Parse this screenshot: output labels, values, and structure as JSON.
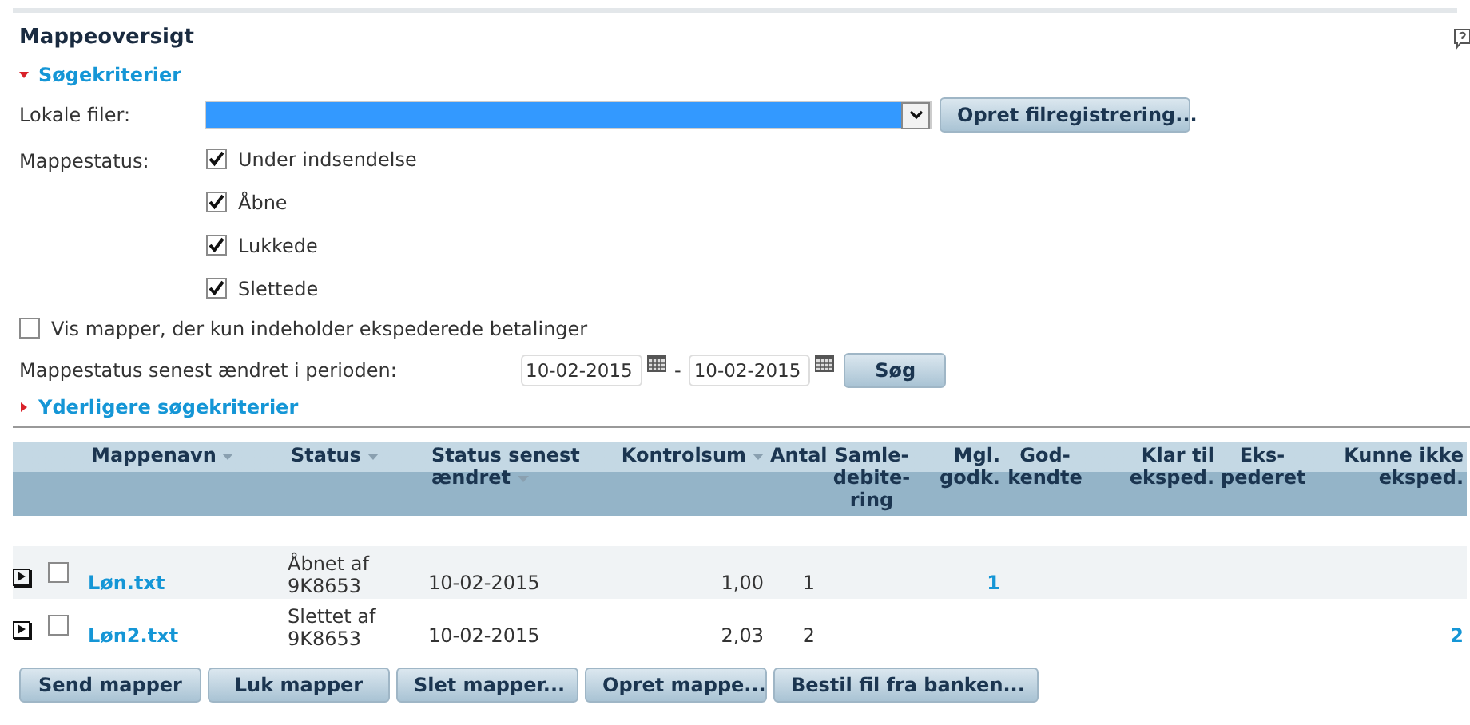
{
  "title": "Mappeoversigt",
  "search_section": {
    "label": "Søgekriterier",
    "expanded": true
  },
  "local_files": {
    "label": "Lokale filer:",
    "button": "Opret filregistrering..."
  },
  "folder_status": {
    "label": "Mappestatus:",
    "options": [
      {
        "label": "Under indsendelse",
        "checked": true
      },
      {
        "label": "Åbne",
        "checked": true
      },
      {
        "label": "Lukkede",
        "checked": true
      },
      {
        "label": "Slettede",
        "checked": true
      }
    ]
  },
  "only_expedited": {
    "label": "Vis mapper, der kun indeholder ekspederede betalinger",
    "checked": false
  },
  "period": {
    "label": "Mappestatus senest ændret i perioden:",
    "from": "10-02-2015",
    "separator": "-",
    "to": "10-02-2015",
    "button": "Søg"
  },
  "more_section": {
    "label": "Yderligere søgekriterier",
    "expanded": false
  },
  "table": {
    "columns": [
      {
        "lines": [
          "Mappenavn"
        ],
        "sortable": true
      },
      {
        "lines": [
          "Status"
        ],
        "sortable": true
      },
      {
        "lines": [
          "Status senest",
          "ændret"
        ],
        "sortable": true
      },
      {
        "lines": [
          "Kontrolsum"
        ],
        "sortable": true
      },
      {
        "lines": [
          "Antal"
        ],
        "sortable": false
      },
      {
        "lines": [
          "Samle-",
          "debite-",
          "ring"
        ],
        "sortable": false
      },
      {
        "lines": [
          "Mgl.",
          "godk."
        ],
        "sortable": false
      },
      {
        "lines": [
          "God-",
          "kendte"
        ],
        "sortable": false
      },
      {
        "lines": [
          "Klar til",
          "eksped."
        ],
        "sortable": false
      },
      {
        "lines": [
          "Eks-",
          "pederet"
        ],
        "sortable": false
      },
      {
        "lines": [
          "Kunne ikke",
          "eksped."
        ],
        "sortable": false
      }
    ],
    "rows": [
      {
        "checked": false,
        "name": "Løn.txt",
        "status": [
          "Åbnet af",
          "9K8653"
        ],
        "changed": "10-02-2015",
        "checksum": "1,00",
        "count": "1",
        "cells": {
          "6": "1"
        }
      },
      {
        "checked": false,
        "name": "Løn2.txt",
        "status": [
          "Slettet af",
          "9K8653"
        ],
        "changed": "10-02-2015",
        "checksum": "2,03",
        "count": "2",
        "cells": {
          "10": "2"
        }
      }
    ]
  },
  "buttons": [
    "Send mapper",
    "Luk mapper",
    "Slet mapper...",
    "Opret mappe...",
    "Bestil fil fra banken..."
  ]
}
